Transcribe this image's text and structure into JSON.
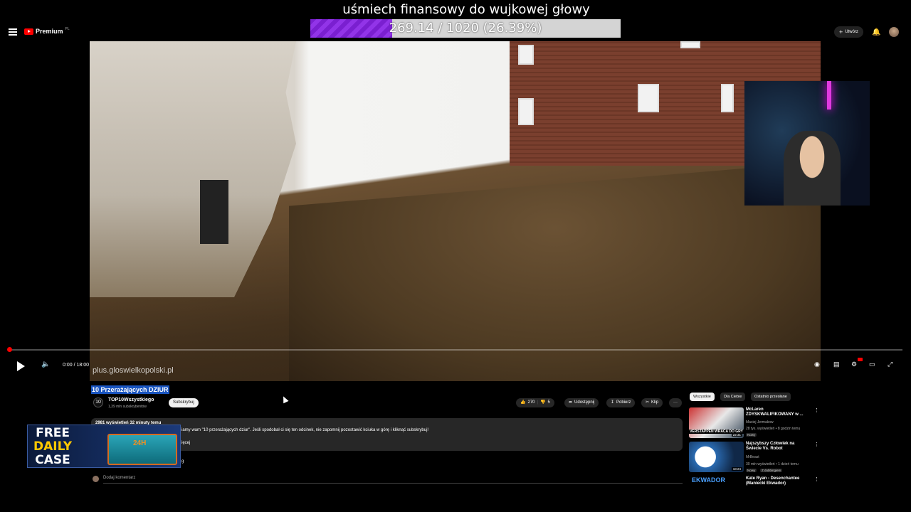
{
  "overlay": {
    "goal_title": "uśmiech finansowy do wujkowej głowy",
    "goal_progress_text": "269.14 / 1020 (26.39%)",
    "goal_fraction": 0.2639
  },
  "header": {
    "logo_text": "Premium",
    "logo_sup": "PL",
    "create_label": "Utwórz"
  },
  "video": {
    "watermark": "plus.gloswielkopolski.pl",
    "time": "0:00 / 18:00",
    "progress_fraction": 0.0
  },
  "details": {
    "title": "10 Przerażających DZIUR",
    "channel_name": "TOP10Wszystkiego",
    "channel_subs": "1,39 mln subskrybentów",
    "subscribe_label": "Subskrybuj",
    "likes": "270",
    "dislikes": "5",
    "share_label": "Udostępnij",
    "download_label": "Pobierz",
    "clip_label": "Klip",
    "more_label": "···",
    "desc_meta": "2981 wyświetleń  32 minuty temu",
    "desc_text": "iamy wam \"10 przerażających dziur\". Jeśli spodobał ci się ten odcinek, nie zapomnij pozostawić kciuka w górę i kliknąć subskrybuj!",
    "desc_more": "ięcej",
    "desc_g": "g",
    "comment_placeholder": "Dodaj komentarz"
  },
  "ad": {
    "line1": "FREE",
    "line2": "DAILY",
    "line3": "CASE",
    "badge": "24H"
  },
  "sidebar": {
    "chips": [
      "Wszystkie",
      "Dla Ciebie",
      "Ostatnio przesłane"
    ],
    "items": [
      {
        "title": "McLaren ZDYSKWALIFIKOWANY w ...",
        "channel": "Maciej Jermakow",
        "meta": "28 tys. wyświetleń • 8 godzin temu",
        "badge": "Nowy",
        "thumb_caption": "VERSTAPPEN WRACA DO GRY",
        "duration": "22:31"
      },
      {
        "title": "Najszybszy Człowiek na Świecie Vs. Robot",
        "channel": "MrBeast",
        "meta": "30 mln wyświetleń • 1 dzień temu",
        "badge": "Nowy",
        "badge2": "Z dubbingiem",
        "duration": "18:24"
      },
      {
        "title": "Kate Ryan - Desenchantee (Maniecki Ekwador)",
        "thumb_caption": "EKWADOR"
      }
    ]
  },
  "colors": {
    "accent_red": "#ff0000",
    "goal_purple": "#8a2be2",
    "title_highlight": "#1a55c0"
  }
}
